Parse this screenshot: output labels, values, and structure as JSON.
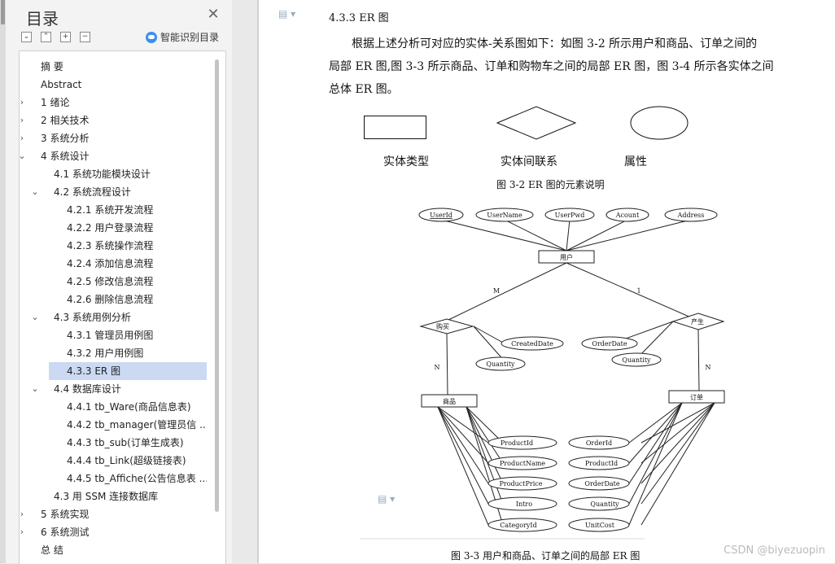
{
  "nav": {
    "title": "目录",
    "smart_toc_label": "智能识别目录",
    "items": [
      {
        "label": "摘  要",
        "level": 0,
        "chevron": "none"
      },
      {
        "label": "Abstract",
        "level": 0,
        "chevron": "none"
      },
      {
        "label": "1 绪论",
        "level": 0,
        "chevron": "right"
      },
      {
        "label": "2 相关技术",
        "level": 0,
        "chevron": "right"
      },
      {
        "label": "3 系统分析",
        "level": 0,
        "chevron": "right"
      },
      {
        "label": "4 系统设计",
        "level": 0,
        "chevron": "down"
      },
      {
        "label": "4.1  系统功能模块设计",
        "level": 1,
        "chevron": "none"
      },
      {
        "label": "4.2 系统流程设计",
        "level": 1,
        "chevron": "down"
      },
      {
        "label": "4.2.1  系统开发流程",
        "level": 2,
        "chevron": "none"
      },
      {
        "label": "4.2.2  用户登录流程",
        "level": 2,
        "chevron": "none"
      },
      {
        "label": "4.2.3  系统操作流程",
        "level": 2,
        "chevron": "none"
      },
      {
        "label": "4.2.4  添加信息流程",
        "level": 2,
        "chevron": "none"
      },
      {
        "label": "4.2.5  修改信息流程",
        "level": 2,
        "chevron": "none"
      },
      {
        "label": "4.2.6  删除信息流程",
        "level": 2,
        "chevron": "none"
      },
      {
        "label": "4.3 系统用例分析",
        "level": 1,
        "chevron": "down"
      },
      {
        "label": "4.3.1  管理员用例图",
        "level": 2,
        "chevron": "none"
      },
      {
        "label": "4.3.2  用户用例图",
        "level": 2,
        "chevron": "none"
      },
      {
        "label": "4.3.3 ER 图",
        "level": 2,
        "chevron": "none",
        "selected": true
      },
      {
        "label": "4.4  数据库设计",
        "level": 1,
        "chevron": "down"
      },
      {
        "label": "4.4.1 tb_Ware(商品信息表)",
        "level": 2,
        "chevron": "none"
      },
      {
        "label": "4.4.2 tb_manager(管理员信 ...",
        "level": 2,
        "chevron": "none"
      },
      {
        "label": "4.4.3 tb_sub(订单生成表)",
        "level": 2,
        "chevron": "none"
      },
      {
        "label": "4.4.4 tb_Link(超级链接表)",
        "level": 2,
        "chevron": "none"
      },
      {
        "label": "4.4.5 tb_Affiche(公告信息表 ...",
        "level": 2,
        "chevron": "none"
      },
      {
        "label": "4.3  用 SSM 连接数据库",
        "level": 1,
        "chevron": "none"
      },
      {
        "label": "5 系统实现",
        "level": 0,
        "chevron": "right"
      },
      {
        "label": "6 系统测试",
        "level": 0,
        "chevron": "right"
      },
      {
        "label": "总  结",
        "level": 0,
        "chevron": "none"
      }
    ]
  },
  "doc": {
    "heading": "4.3.3 ER 图",
    "para": [
      "根据上述分析可对应的实体-关系图如下：如图 3-2 所示用户和商品、订单之间的",
      "局部 ER 图,图 3-3 所示商品、订单和购物车之间的局部 ER 图，图 3-4 所示各实体之间",
      "总体 ER 图。"
    ],
    "legend": {
      "entity": "实体类型",
      "relation": "实体间联系",
      "attribute": "属性"
    },
    "caption_32": "图 3-2 ER 图的元素说明",
    "caption_33": "图 3-3   用户和商品、订单之间的局部 ER 图"
  },
  "er": {
    "user_entity": "用户",
    "goods_entity": "商品",
    "order_entity": "订单",
    "buy_relation": "购买",
    "produce_relation": "产生",
    "user_attrs": [
      "UserId",
      "UserName",
      "UserPwd",
      "Acount",
      "Address"
    ],
    "buy_attrs": [
      "CreatedDate",
      "Quantity"
    ],
    "produce_attrs": [
      "OrderDate",
      "Quantity"
    ],
    "goods_attrs": [
      "ProductId",
      "ProductName",
      "ProductPrice",
      "Intro",
      "CategoryId"
    ],
    "order_attrs": [
      "OrderId",
      "ProductId",
      "OrderDate",
      "Quantity",
      "UnitCost"
    ],
    "card_m": "M",
    "card_1": "1",
    "card_n1": "N",
    "card_n2": "N"
  },
  "watermark": "CSDN @biyezuopin"
}
